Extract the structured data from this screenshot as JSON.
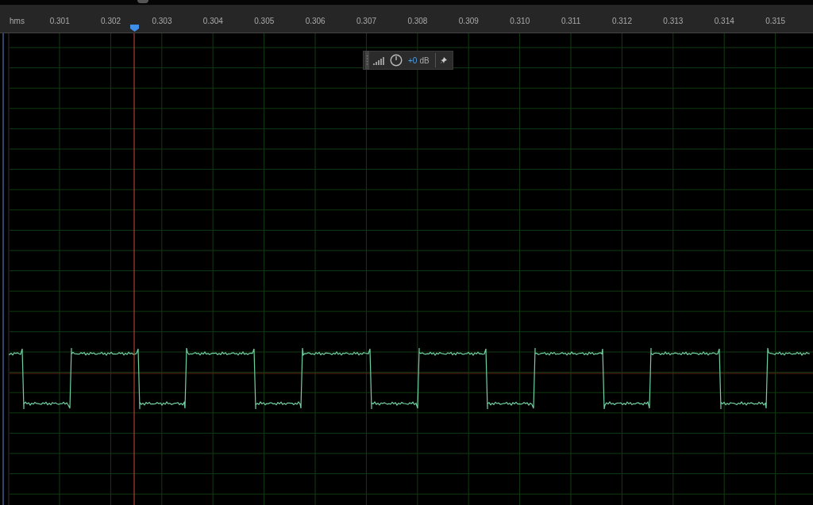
{
  "ruler": {
    "unit": "hms",
    "labels": [
      "0.301",
      "0.302",
      "0.303",
      "0.304",
      "0.305",
      "0.306",
      "0.307",
      "0.308",
      "0.309",
      "0.310",
      "0.311",
      "0.312",
      "0.313",
      "0.314",
      "0.315"
    ]
  },
  "hud": {
    "level_value": "+0",
    "level_unit": "dB"
  }
}
